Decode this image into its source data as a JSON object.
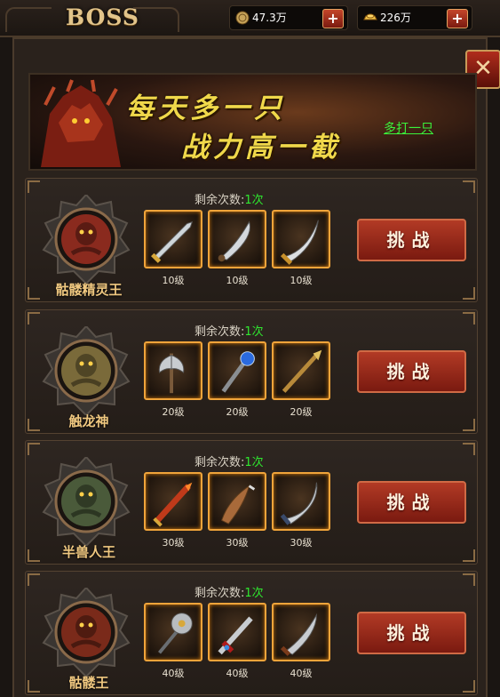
{
  "header": {
    "title": "BOSS",
    "coins": {
      "value": "47.3万",
      "icon": "coin-icon"
    },
    "gold": {
      "value": "226万",
      "icon": "gold-ingot-icon"
    },
    "plus_label": "+"
  },
  "close_label": "✕",
  "banner": {
    "line1": "每天多一只",
    "line2": "战力高一截",
    "link": "多打一只"
  },
  "remain_label": "剩余次数:",
  "challenge_label": "挑战",
  "bosses": [
    {
      "name": "骷髅精灵王",
      "remain": "1次",
      "color": "#8a2a1e",
      "rewards": [
        {
          "level": "10级",
          "icon": "dagger-icon"
        },
        {
          "level": "10级",
          "icon": "curved-dagger-icon"
        },
        {
          "level": "10级",
          "icon": "curved-sword-icon"
        }
      ]
    },
    {
      "name": "触龙神",
      "remain": "1次",
      "color": "#7a6a3a",
      "rewards": [
        {
          "level": "20级",
          "icon": "double-axe-icon"
        },
        {
          "level": "20级",
          "icon": "staff-icon"
        },
        {
          "level": "20级",
          "icon": "spear-icon"
        }
      ]
    },
    {
      "name": "半兽人王",
      "remain": "1次",
      "color": "#4a5a3a",
      "rewards": [
        {
          "level": "30级",
          "icon": "fire-sword-icon"
        },
        {
          "level": "30级",
          "icon": "blade-icon"
        },
        {
          "level": "30级",
          "icon": "scimitar-icon"
        }
      ]
    },
    {
      "name": "骷髅王",
      "remain": "1次",
      "color": "#7a2a1a",
      "rewards": [
        {
          "level": "40级",
          "icon": "battle-axe-icon"
        },
        {
          "level": "40级",
          "icon": "jeweled-sword-icon"
        },
        {
          "level": "40级",
          "icon": "machete-icon"
        }
      ]
    }
  ]
}
